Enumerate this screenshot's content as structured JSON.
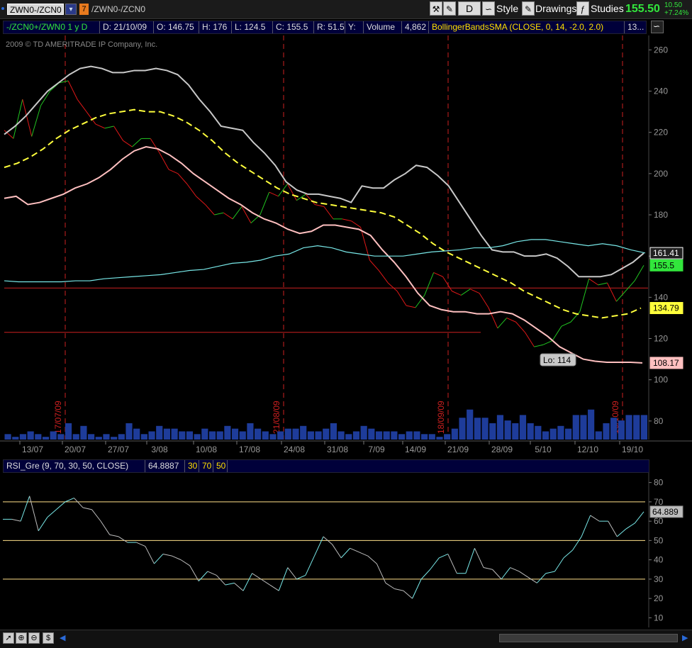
{
  "toolbar": {
    "symbol_field": "ZWN0-/ZCN0",
    "link_badge": "7",
    "symbol_display": "/ZWN0-/ZCN0",
    "period_button": "D",
    "style_label": "Style",
    "drawings_label": "Drawings",
    "studies_label": "Studies",
    "last_price": "155.50",
    "change_abs": "10.50",
    "change_pct": "+7.24%"
  },
  "infobar": {
    "symbol": "-/ZCN0+/ZWN0 1 y D",
    "date": "D: 21/10/09",
    "open": "O: 146.75",
    "high": "H: 176",
    "low": "L: 124.5",
    "close": "C: 155.5",
    "range": "R: 51.5",
    "yval": "Y:",
    "volume_label": "Volume",
    "volume_value": "4,862",
    "study": "BollingerBandsSMA (CLOSE, 0, 14, -2.0, 2.0)",
    "more": "13..."
  },
  "copyright": "2009 © TD AMERITRADE IP Company, Inc.",
  "rsi_header": {
    "study": "RSI_Gre (9, 70, 30, 50, CLOSE)",
    "value": "64.8887",
    "level_low": "30",
    "level_high": "70",
    "level_mid": "50"
  },
  "colors": {
    "background": "#000000",
    "up": "#21c421",
    "down": "#e01818",
    "bb_upper": "#c8c8c8",
    "bb_mid": "#ffff3c",
    "bb_lower": "#ffc0c0",
    "second": "#78e8e8",
    "volume": "#1e3c9a",
    "vline": "#cc2020",
    "rsi_levels": "#ffe08a"
  },
  "chart_data": [
    {
      "type": "line",
      "title": "",
      "xlabel": "",
      "ylabel": "",
      "ylim": [
        71,
        267
      ],
      "y_ticks": [
        80,
        100,
        120,
        140,
        160,
        180,
        200,
        220,
        240,
        260
      ],
      "x_tick_labels": [
        "13/07",
        "20/07",
        "27/07",
        "3/08",
        "10/08",
        "17/08",
        "24/08",
        "31/08",
        "7/09",
        "14/09",
        "21/09",
        "28/09",
        "5/10",
        "12/10",
        "19/10"
      ],
      "vline_labels": [
        "17/07/09",
        "21/08/09",
        "18/09/09",
        "16/10/09"
      ],
      "grid": false,
      "series": [
        {
          "name": "Price",
          "role": "price",
          "values": [
            221,
            217,
            236,
            218,
            233,
            240,
            244,
            245,
            236,
            230,
            224,
            222,
            223,
            216,
            213,
            217,
            217,
            210,
            202,
            200,
            195,
            189,
            185,
            180,
            181,
            178,
            184,
            176,
            180,
            191,
            189,
            195,
            187,
            190,
            185,
            184,
            178,
            178,
            177,
            174,
            158,
            153,
            147,
            143,
            136,
            135,
            141,
            152,
            150,
            143,
            141,
            144,
            142,
            135,
            125,
            130,
            128,
            123,
            116,
            117,
            119,
            126,
            128,
            133,
            149,
            146,
            147,
            138,
            143,
            148,
            155.5
          ]
        },
        {
          "name": "BB Upper",
          "role": "bb_upper",
          "values": [
            219,
            223,
            228,
            234,
            240,
            244,
            248,
            251,
            252,
            251,
            249,
            249,
            250,
            250,
            251,
            250,
            248,
            243,
            236,
            230,
            223,
            222,
            221,
            215,
            210,
            204,
            196,
            192,
            190,
            190,
            189,
            188,
            186,
            194,
            193,
            193,
            197,
            200,
            204,
            203,
            199,
            194,
            186,
            178,
            170,
            163,
            162,
            162,
            160,
            160,
            161,
            159,
            155,
            150,
            150,
            150,
            151,
            154,
            157,
            161.41
          ]
        },
        {
          "name": "BB Mid",
          "role": "bb_mid",
          "values": [
            203,
            205,
            208,
            212,
            217,
            221,
            224,
            227,
            229,
            230,
            231,
            230,
            230,
            228,
            225,
            221,
            216,
            210,
            205,
            201,
            197,
            193,
            190,
            188,
            186,
            185,
            184,
            183,
            182,
            181,
            179,
            175,
            171,
            166,
            162,
            159,
            156,
            153,
            150,
            147,
            143,
            140,
            137,
            134,
            132,
            131,
            130,
            131,
            132,
            134.79
          ]
        },
        {
          "name": "BB Lower",
          "role": "bb_lower",
          "values": [
            188,
            189,
            185,
            186,
            188,
            190,
            193,
            195,
            198,
            202,
            207,
            211,
            213,
            212,
            209,
            205,
            200,
            196,
            192,
            188,
            185,
            181,
            178,
            176,
            173,
            171,
            172,
            175,
            175,
            174,
            173,
            170,
            163,
            157,
            150,
            142,
            136,
            134,
            133,
            133,
            132,
            132,
            133,
            132,
            129,
            125,
            121,
            116,
            113,
            110,
            109,
            108.5,
            108.5,
            108.5,
            108.17
          ]
        },
        {
          "name": "Second",
          "role": "second",
          "values": [
            148,
            147.5,
            147.5,
            147.5,
            147.5,
            148,
            148,
            149,
            149.5,
            150,
            150.5,
            151,
            152,
            153,
            153.5,
            155,
            156.5,
            157,
            158,
            160,
            161,
            164,
            165,
            164,
            162,
            161,
            160,
            160,
            160,
            161,
            162,
            162.5,
            163,
            164,
            164,
            165,
            167,
            168,
            168,
            167,
            166,
            165,
            166,
            165,
            163,
            161.5
          ]
        }
      ],
      "horizontal_lines": [
        144.5,
        123
      ],
      "last_labels": {
        "bb_upper": "161.41",
        "price": "155.5",
        "bb_mid": "134.79",
        "bb_lower": "108.17"
      },
      "annotation": "Lo: 114"
    },
    {
      "type": "bar",
      "title": "",
      "role": "volume",
      "values": [
        2,
        1,
        2,
        3,
        2,
        1,
        3,
        2,
        6,
        2,
        5,
        2,
        1,
        2,
        1,
        2,
        6,
        4,
        2,
        3,
        5,
        4,
        4,
        3,
        3,
        2,
        4,
        3,
        3,
        5,
        4,
        3,
        6,
        4,
        3,
        2,
        3,
        4,
        4,
        5,
        3,
        3,
        4,
        6,
        3,
        2,
        3,
        5,
        4,
        3,
        3,
        3,
        2,
        3,
        3,
        2,
        2,
        1,
        2,
        4,
        8,
        11,
        8,
        8,
        6,
        9,
        7,
        6,
        9,
        6,
        5,
        3,
        4,
        5,
        4,
        9,
        9,
        11,
        3,
        6,
        8,
        7,
        9,
        9,
        9
      ]
    },
    {
      "type": "line",
      "title": "",
      "role": "rsi",
      "ylim": [
        5,
        85
      ],
      "y_ticks": [
        10,
        20,
        30,
        40,
        50,
        60,
        70,
        80
      ],
      "levels": [
        30,
        50,
        70
      ],
      "values": [
        61,
        61,
        60,
        73,
        55,
        62,
        66,
        70,
        72,
        67,
        66,
        60,
        53,
        52,
        49,
        49,
        47,
        38,
        43,
        42,
        40,
        37,
        29,
        34,
        32,
        27,
        28,
        24,
        33,
        30,
        27,
        24,
        36,
        30,
        32,
        42,
        52,
        48,
        41,
        46,
        44,
        42,
        38,
        28,
        25,
        24,
        20,
        30,
        35,
        41,
        43,
        33,
        33,
        46,
        36,
        35,
        30,
        36,
        34,
        31,
        28,
        33,
        34,
        41,
        45,
        52,
        63,
        60,
        60,
        52,
        56,
        59,
        64.889
      ],
      "last_label": "64.889"
    }
  ]
}
